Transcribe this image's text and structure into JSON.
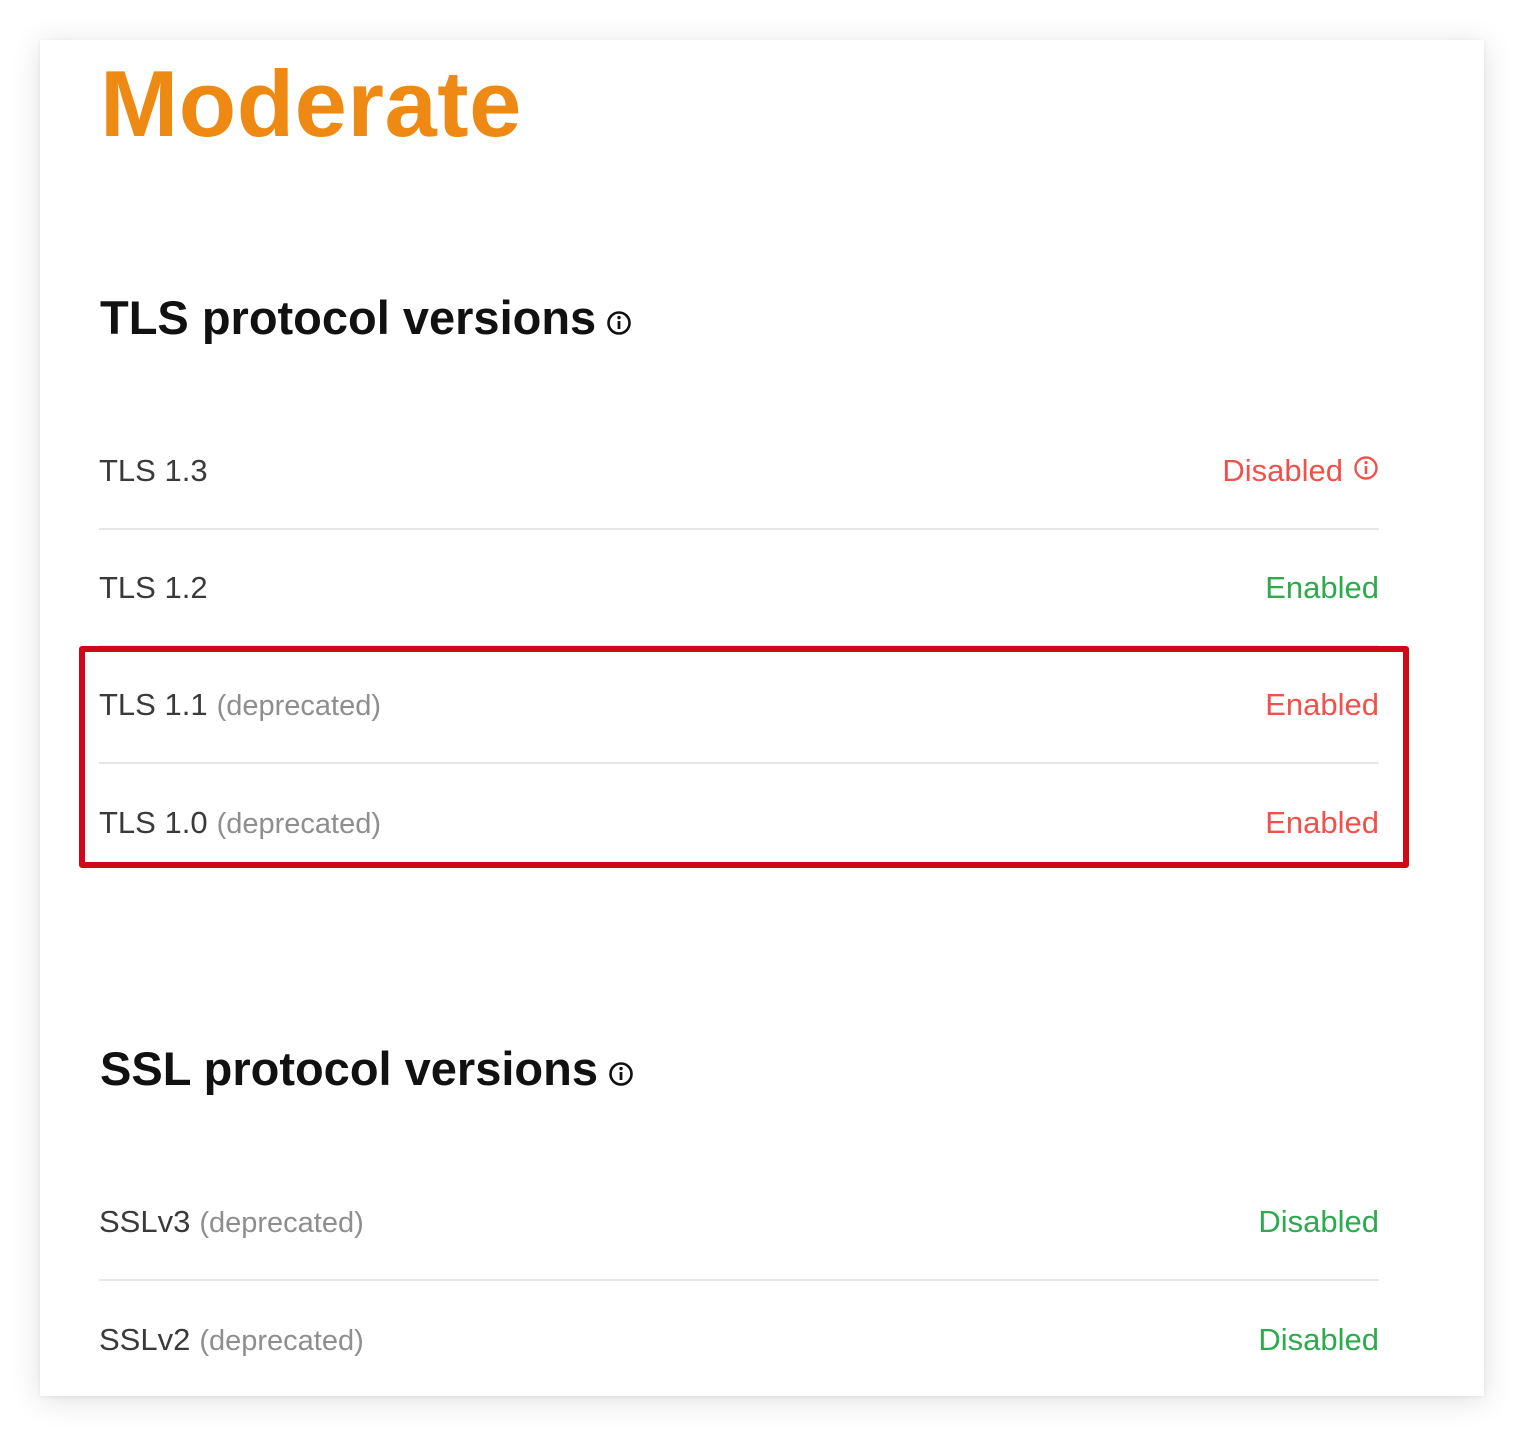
{
  "grade": {
    "label": "Moderate",
    "color": "#ee8a13"
  },
  "tls": {
    "title": "TLS protocol versions",
    "info_icon": "info-icon",
    "rows": [
      {
        "name": "TLS 1.3",
        "note": "",
        "status": "Disabled",
        "status_color": "#f0524b",
        "status_icon": "info-icon"
      },
      {
        "name": "TLS 1.2",
        "note": "",
        "status": "Enabled",
        "status_color": "#2eaa4e"
      },
      {
        "name": "TLS 1.1",
        "note": "(deprecated)",
        "status": "Enabled",
        "status_color": "#f0524b"
      },
      {
        "name": "TLS 1.0",
        "note": "(deprecated)",
        "status": "Enabled",
        "status_color": "#f0524b"
      }
    ]
  },
  "ssl": {
    "title": "SSL protocol versions",
    "info_icon": "info-icon",
    "rows": [
      {
        "name": "SSLv3",
        "note": "(deprecated)",
        "status": "Disabled",
        "status_color": "#2eaa4e"
      },
      {
        "name": "SSLv2",
        "note": "(deprecated)",
        "status": "Disabled",
        "status_color": "#2eaa4e"
      }
    ]
  },
  "highlight": {
    "color": "#cf0a18",
    "covers": [
      "TLS 1.1",
      "TLS 1.0"
    ]
  }
}
